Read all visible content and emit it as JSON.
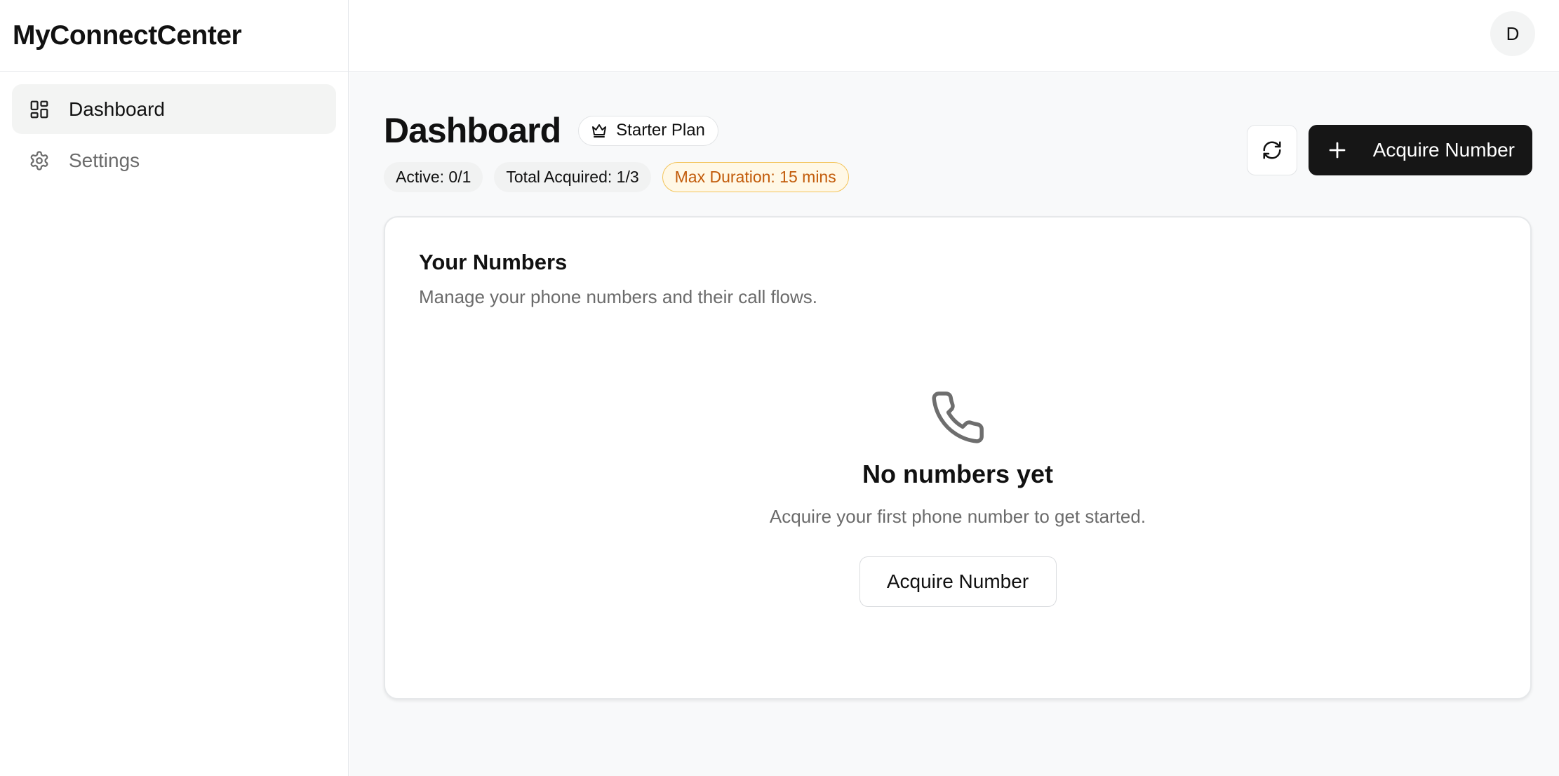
{
  "app": {
    "brand": "MyConnectCenter"
  },
  "sidebar": {
    "items": [
      {
        "label": "Dashboard",
        "icon": "dashboard-icon",
        "active": true
      },
      {
        "label": "Settings",
        "icon": "gear-icon",
        "active": false
      }
    ]
  },
  "topbar": {
    "avatar_initial": "D"
  },
  "header": {
    "title": "Dashboard",
    "plan_badge": {
      "label": "Starter Plan",
      "icon": "crown-icon"
    },
    "stats": {
      "active": "Active: 0/1",
      "total_acquired": "Total Acquired: 1/3",
      "max_duration": "Max Duration: 15 mins"
    },
    "actions": {
      "refresh_icon": "refresh-icon",
      "acquire_label": "Acquire Number",
      "acquire_icon": "plus-icon"
    }
  },
  "numbers_card": {
    "title": "Your Numbers",
    "subtitle": "Manage your phone numbers and their call flows.",
    "empty_state": {
      "icon": "phone-icon",
      "title": "No numbers yet",
      "subtitle": "Acquire your first phone number to get started.",
      "button_label": "Acquire Number"
    }
  },
  "colors": {
    "primary_button": "#161616",
    "warning_text": "#c25b0a",
    "warning_border": "#f3c45a",
    "main_background": "#f8f9fa"
  }
}
